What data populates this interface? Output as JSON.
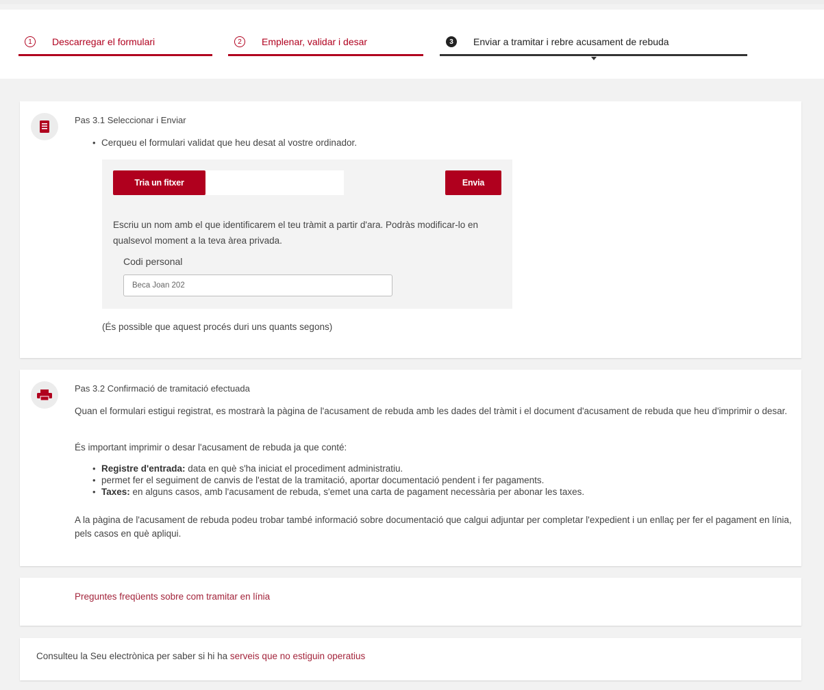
{
  "tabs": [
    {
      "num": "1",
      "label": "Descarregar el formulari"
    },
    {
      "num": "2",
      "label": "Emplenar, validar i desar"
    },
    {
      "num": "3",
      "label": "Enviar a tramitar i rebre acusament de rebuda"
    }
  ],
  "step1": {
    "title": "Pas 3.1 Seleccionar i Enviar",
    "bullet": "Cerqueu el formulari validat que heu desat al vostre ordinador.",
    "choose_file_label": "Tria un fitxer",
    "file_name": "",
    "send_label": "Envia",
    "help_text": "Escriu un nom amb el que identificarem el teu tràmit a partir d'ara. Podràs modificar-lo en qualsevol moment a la teva àrea privada.",
    "field_label": "Codi personal",
    "field_value": "Beca Joan 202",
    "note": "(És possible que aquest procés duri uns quants segons)"
  },
  "step2": {
    "title": "Pas 3.2 Confirmació de tramitació efectuada",
    "para1": "Quan el formulari estigui registrat, es mostrarà la pàgina de l'acusament de rebuda amb les dades del tràmit i el document d'acusament de rebuda que heu d'imprimir o desar.",
    "para2": "És important imprimir o desar l'acusament de rebuda ja que conté:",
    "items": [
      {
        "bold": "Registre d'entrada:",
        "text": " data en què s'ha iniciat el procediment administratiu."
      },
      {
        "bold": "",
        "text": "permet fer el seguiment de canvis de l'estat de la tramitació, aportar documentació pendent i fer pagaments."
      },
      {
        "bold": "Taxes:",
        "text": " en alguns casos, amb l'acusament de rebuda, s'emet una carta de pagament necessària per abonar les taxes."
      }
    ],
    "para3": "A la pàgina de l'acusament de rebuda podeu trobar també informació sobre documentació que calgui adjuntar per completar l'expedient i un enllaç per fer el pagament en línia, pels casos en què apliqui."
  },
  "faq": {
    "link": "Preguntes freqüents sobre com tramitar en línia"
  },
  "footer": {
    "text": "Consulteu la Seu electrònica per saber si hi ha ",
    "link": "serveis que no estiguin operatius"
  },
  "colors": {
    "accent": "#b0001e",
    "link": "#a3243b"
  }
}
